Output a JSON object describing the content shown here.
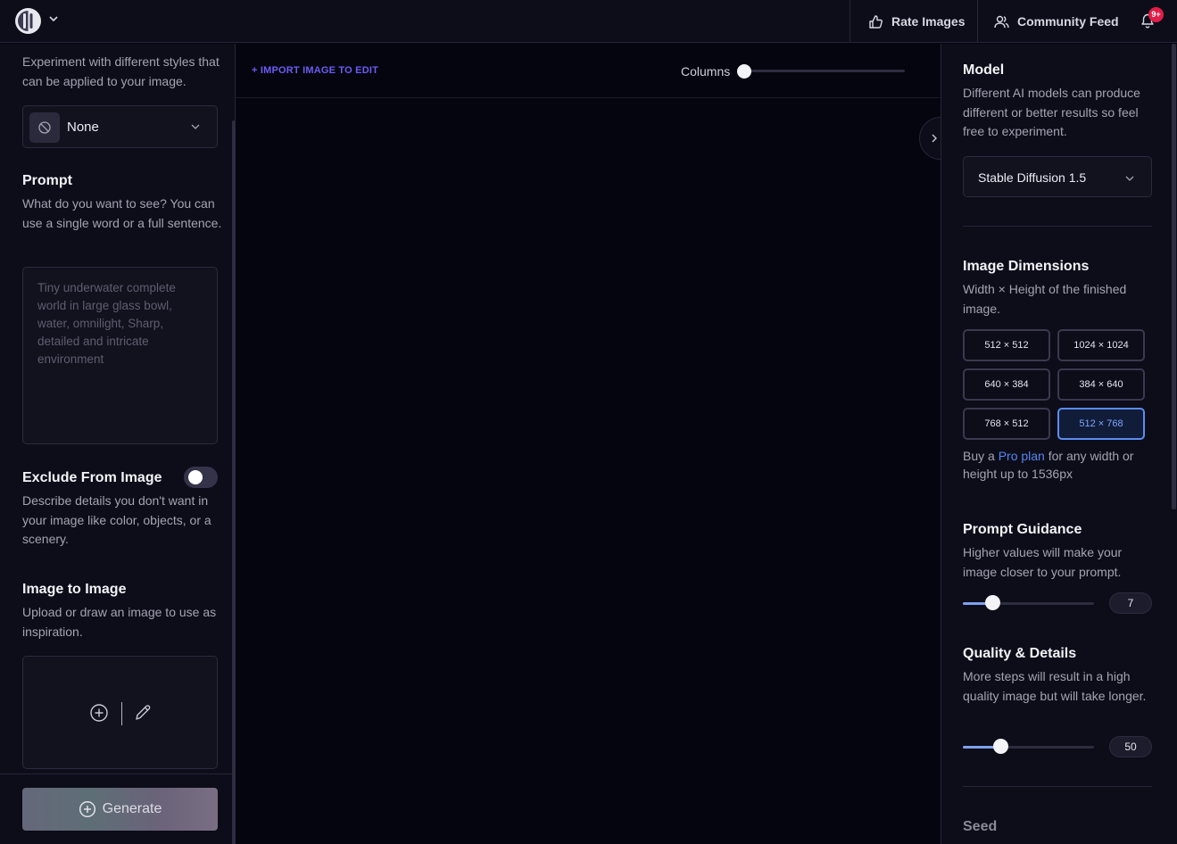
{
  "topbar": {
    "rate_images": "Rate Images",
    "community_feed": "Community Feed",
    "notification_badge": "9+"
  },
  "left_panel": {
    "style_hint": "Experiment with different styles that can be applied to your image.",
    "style_value": "None",
    "prompt_heading": "Prompt",
    "prompt_hint": "What do you want to see? You can use a single word or a full sentence.",
    "prompt_placeholder": "Tiny underwater complete world in large glass bowl, water, omnilight, Sharp, detailed and intricate environment",
    "exclude_heading": "Exclude From Image",
    "exclude_enabled": false,
    "exclude_hint": "Describe details you don't want in your image like color, objects, or a scenery.",
    "img2img_heading": "Image to Image",
    "img2img_hint": "Upload or draw an image to use as inspiration.",
    "generate_label": "Generate"
  },
  "canvas": {
    "import_label": "+ IMPORT IMAGE TO EDIT",
    "columns_label": "Columns"
  },
  "right_panel": {
    "model_heading": "Model",
    "model_hint": "Different AI models can produce different or better results so feel free to experiment.",
    "model_value": "Stable Diffusion 1.5",
    "dimensions_heading": "Image Dimensions",
    "dimensions_hint": "Width × Height of the finished image.",
    "dimensions": [
      "512 × 512",
      "1024 × 1024",
      "640 × 384",
      "384 × 640",
      "768 × 512",
      "512 × 768"
    ],
    "selected_dimension": "512 × 768",
    "pro_prefix": "Buy a ",
    "pro_link": "Pro plan",
    "pro_suffix": " for any width or height up to 1536px",
    "guidance_heading": "Prompt Guidance",
    "guidance_hint": "Higher values will make your image closer to your prompt.",
    "guidance_value": "7",
    "quality_heading": "Quality & Details",
    "quality_hint": "More steps will result in a high quality image but will take longer.",
    "quality_value": "50",
    "seed_heading": "Seed"
  },
  "colors": {
    "accent": "#6b5cf6",
    "link": "#4f88f0",
    "selected_border": "#5b8def",
    "badge": "#e11d48"
  }
}
